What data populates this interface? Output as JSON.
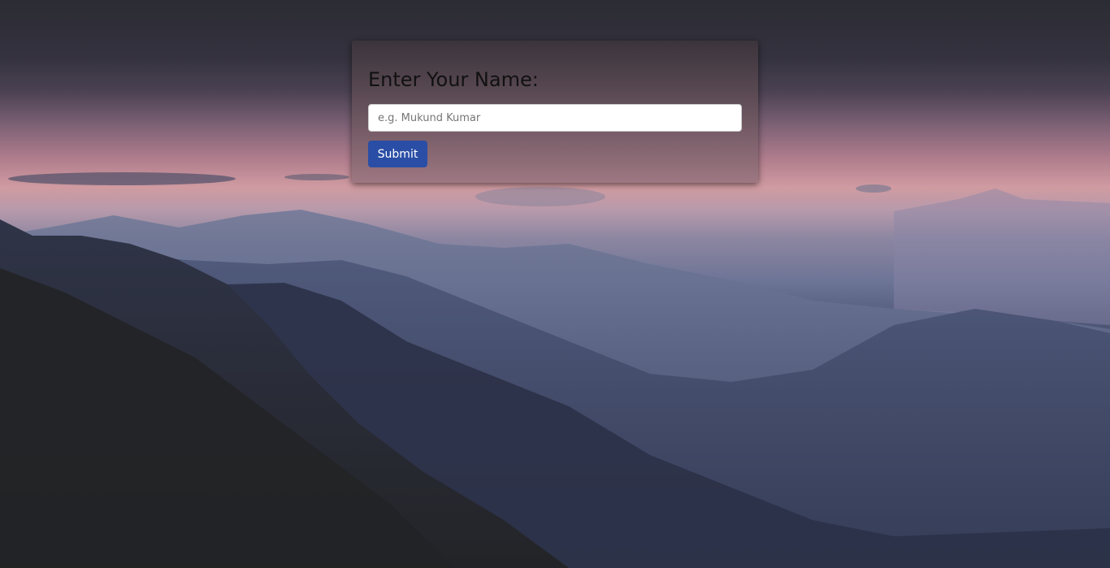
{
  "form": {
    "title": "Enter Your Name:",
    "name_placeholder": "e.g. Mukund Kumar",
    "name_value": "",
    "submit_label": "Submit"
  },
  "colors": {
    "submit_button": "#2a4ea5",
    "page_background": "#222222"
  }
}
